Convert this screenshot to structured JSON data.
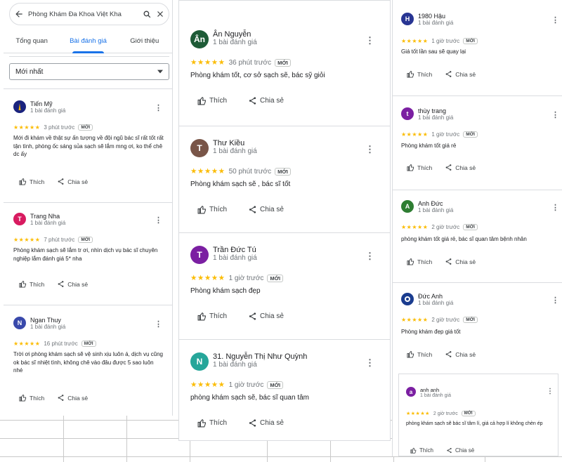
{
  "header": {
    "search_text": "Phòng Khám Đa Khoa Việt Kha",
    "tabs": [
      {
        "label": "Tổng quan"
      },
      {
        "label": "Bài đánh giá"
      },
      {
        "label": "Giới thiệu"
      }
    ],
    "sort_label": "Mới nhất"
  },
  "common": {
    "like_label": "Thích",
    "share_label": "Chia sẻ",
    "new_badge": "MỚI",
    "stars": "★★★★★"
  },
  "colors": {
    "star": "#fbbc04",
    "accent": "#1a73e8"
  },
  "column1": [
    {
      "name": "Tiến Mỹ",
      "count": "1 bài đánh giá",
      "time": "3 phút trước",
      "text": "Mới đi khám về thật sự ấn tượng về đội ngũ bác sĩ rất tốt rất tận tình, phòng ốc sáng sủa sạch sẽ lắm mng ơi, ko thể chê dc ấy",
      "initial": "",
      "color": "#3949ab"
    },
    {
      "name": "Trang Nha",
      "count": "1 bài đánh giá",
      "time": "7 phút trước",
      "text": "Phòng khám sạch sẽ lắm tr ơi, nhìn dịch vụ bác sĩ chuyên nghiệp lắm đánh giá 5* nha",
      "initial": "T",
      "color": "#d81b60"
    },
    {
      "name": "Ngan Thuy",
      "count": "1 bài đánh giá",
      "time": "16 phút trước",
      "text": "Trời ơi phòng khám sạch sẽ vệ sinh xịu luôn á, dịch vụ cũng ok bác sĩ nhiệt tình, không chê vào đâu được 5 sao luôn nhé",
      "initial": "N",
      "color": "#3949ab"
    }
  ],
  "column2": [
    {
      "name": "Ân Nguyễn",
      "count": "1 bài đánh giá",
      "time": "36 phút trước",
      "text": "Phòng khám tốt, cơ sở sạch sẽ, bác sỹ giỏi",
      "initial": "Ân",
      "color": "#1e5b37"
    },
    {
      "name": "Thư Kiều",
      "count": "1 bài đánh giá",
      "time": "50 phút trước",
      "text": "Phòng khám sạch sẽ , bác sĩ tốt",
      "initial": "T",
      "color": "#795548"
    },
    {
      "name": "Trần Đức Tú",
      "count": "1 bài đánh giá",
      "time": "1 giờ trước",
      "text": "Phòng khám sạch đẹp",
      "initial": "T",
      "color": "#7b1fa2"
    },
    {
      "name": "31. Nguyễn Thị Như Quỳnh",
      "count": "1 bài đánh giá",
      "time": "1 giờ trước",
      "text": "phòng khám sạch sẽ, bác sĩ quan tâm",
      "initial": "N",
      "color": "#26a69a"
    }
  ],
  "column3": [
    {
      "name": "1980 Hậu",
      "count": "1 bài đánh giá",
      "time": "1 giờ trước",
      "text": "Giá tốt lần sau sẽ quay lại",
      "initial": "H",
      "color": "#283593"
    },
    {
      "name": "thùy trang",
      "count": "1 bài đánh giá",
      "time": "1 giờ trước",
      "text": "Phòng khám tốt giá rẻ",
      "initial": "t",
      "color": "#7b1fa2"
    },
    {
      "name": "Anh Đức",
      "count": "1 bài đánh giá",
      "time": "2 giờ trước",
      "text": "phòng khám tốt giá rẻ, bác sĩ quan tâm bệnh nhân",
      "initial": "A",
      "color": "#2e7d32"
    },
    {
      "name": "Đức Anh",
      "count": "1 bài đánh giá",
      "time": "2 giờ trước",
      "text": "Phòng khám đẹp giá tốt",
      "initial": "",
      "color": "#1a3c8f"
    },
    {
      "name": "anh anh",
      "count": "1 bài đánh giá",
      "time": "2 giờ trước",
      "text": "phòng khám sạch sẽ bác sĩ tâm lí, giá cả hợp lí không chèn ép",
      "initial": "a",
      "color": "#7b1fa2"
    }
  ]
}
